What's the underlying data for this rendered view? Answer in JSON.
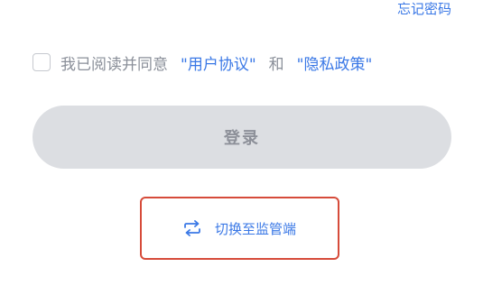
{
  "forgot_password": "忘记密码",
  "agreement": {
    "prefix": "我已阅读并同意",
    "user_agreement": "\"用户协议\"",
    "conjunction": "和",
    "privacy_policy": "\"隐私政策\"",
    "checked": false
  },
  "login_button": "登录",
  "switch_link": {
    "label": "切换至监管端",
    "icon": "swap-arrows-icon"
  },
  "colors": {
    "link": "#3a78e6",
    "button_bg": "#dcdee2",
    "button_text": "#8d9099",
    "highlight_border": "#d64b3a"
  }
}
